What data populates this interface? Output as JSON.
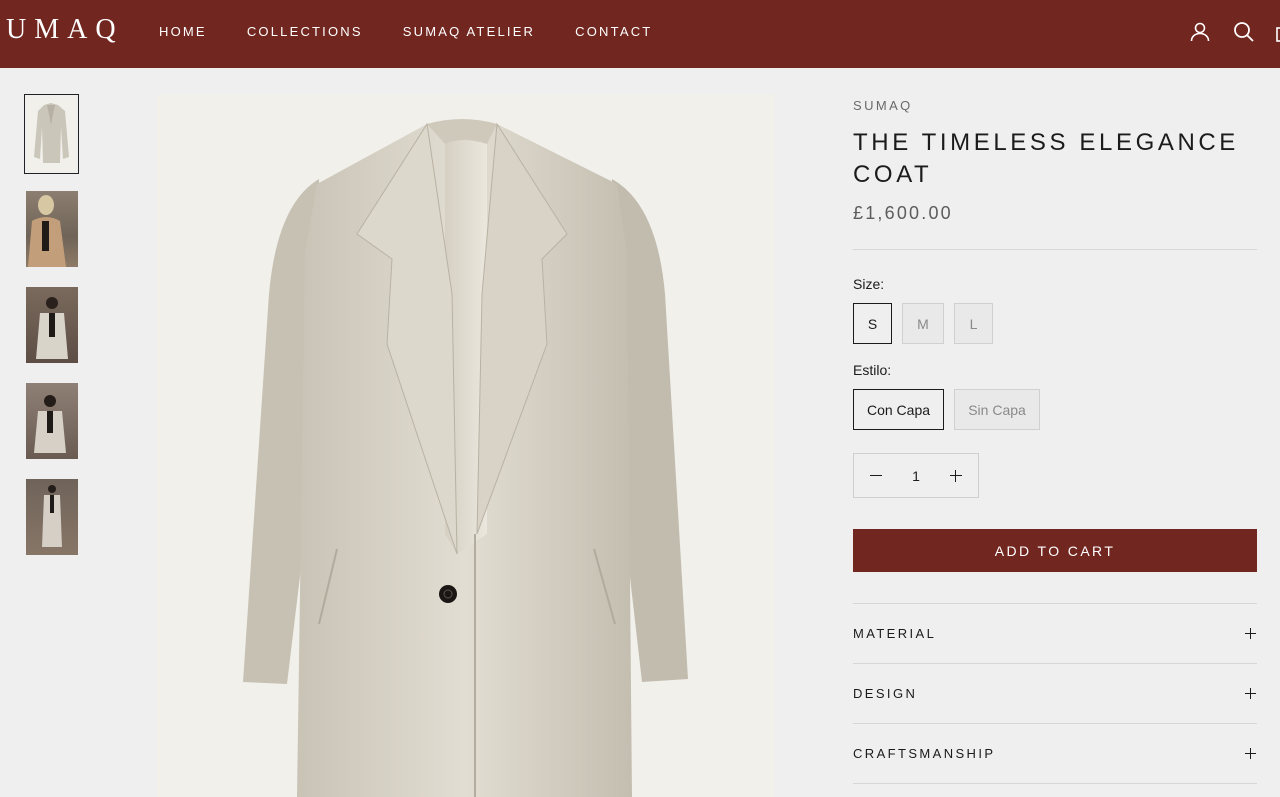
{
  "header": {
    "logo": "UMAQ",
    "nav": [
      "HOME",
      "COLLECTIONS",
      "SUMAQ ATELIER",
      "CONTACT"
    ],
    "icons": [
      "account-icon",
      "search-icon",
      "cart-icon"
    ]
  },
  "colors": {
    "brand": "#722620",
    "background": "#efefef"
  },
  "gallery": {
    "thumbnail_count": 5,
    "active_index": 0
  },
  "product": {
    "vendor": "SUMAQ",
    "title": "THE TIMELESS ELEGANCE COAT",
    "price": "£1,600.00",
    "size_label": "Size:",
    "sizes": [
      "S",
      "M",
      "L"
    ],
    "selected_size": "S",
    "style_label": "Estilo:",
    "styles": [
      "Con Capa",
      "Sin Capa"
    ],
    "selected_style": "Con Capa",
    "quantity": "1",
    "add_to_cart": "ADD TO CART",
    "accordions": [
      "MATERIAL",
      "DESIGN",
      "CRAFTSMANSHIP"
    ]
  }
}
